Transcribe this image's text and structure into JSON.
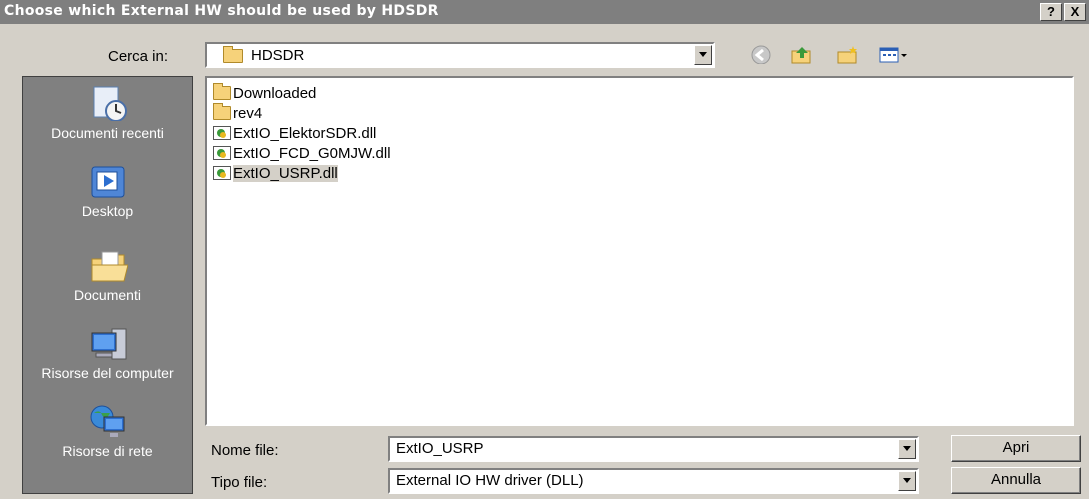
{
  "window": {
    "title": "Choose which External HW should be used by HDSDR",
    "help_btn": "?",
    "close_btn": "X"
  },
  "lookin": {
    "label": "Cerca in:",
    "value": "HDSDR"
  },
  "places": [
    {
      "label": "Documenti recenti",
      "icon": "recent-documents-icon"
    },
    {
      "label": "Desktop",
      "icon": "desktop-icon"
    },
    {
      "label": "Documenti",
      "icon": "documents-folder-icon"
    },
    {
      "label": "Risorse del computer",
      "icon": "computer-icon"
    },
    {
      "label": "Risorse di rete",
      "icon": "network-icon"
    }
  ],
  "files": [
    {
      "name": "Downloaded",
      "type": "folder"
    },
    {
      "name": "rev4",
      "type": "folder"
    },
    {
      "name": "ExtIO_ElektorSDR.dll",
      "type": "dll"
    },
    {
      "name": "ExtIO_FCD_G0MJW.dll",
      "type": "dll"
    },
    {
      "name": "ExtIO_USRP.dll",
      "type": "dll",
      "selected": true
    }
  ],
  "filename": {
    "label": "Nome file:",
    "value": "ExtIO_USRP"
  },
  "filetype": {
    "label": "Tipo file:",
    "value": "External IO HW driver (DLL)"
  },
  "buttons": {
    "open": "Apri",
    "cancel": "Annulla"
  },
  "colors": {
    "titlebar": "#7f7f7f",
    "face": "#d4d0c8",
    "places_bg": "#808080"
  }
}
